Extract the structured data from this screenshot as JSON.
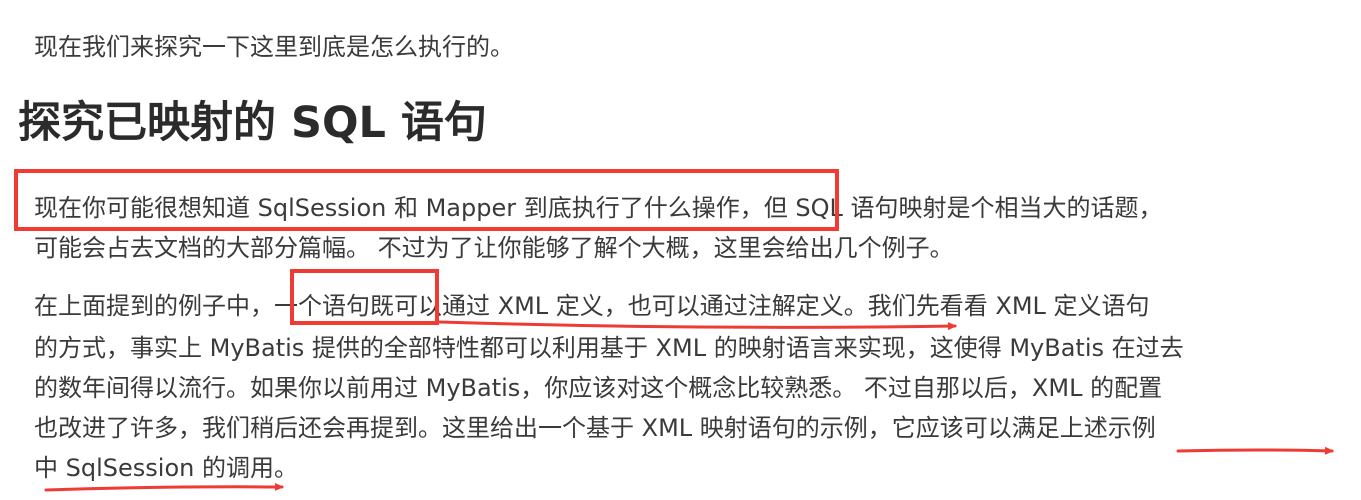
{
  "intro": "现在我们来探究一下这里到底是怎么执行的。",
  "heading": "探究已映射的 SQL 语句",
  "paragraph1": {
    "line1": "现在你可能很想知道 SqlSession 和 Mapper 到底执行了什么操作，但 SQL 语句映射是个相当大的话题，",
    "line2": "可能会占去文档的大部分篇幅。 不过为了让你能够了解个大概，这里会给出几个例子。"
  },
  "paragraph2": {
    "line1": "在上面提到的例子中，一个语句既可以通过 XML 定义，也可以通过注解定义。我们先看看 XML 定义语句",
    "line2": "的方式，事实上 MyBatis 提供的全部特性都可以利用基于 XML 的映射语言来实现，这使得 MyBatis 在过去",
    "line3": "的数年间得以流行。如果你以前用过 MyBatis，你应该对这个概念比较熟悉。 不过自那以后，XML 的配置",
    "line4": "也改进了许多，我们稍后还会再提到。这里给出一个基于 XML 映射语句的示例，它应该可以满足上述示例",
    "line5": "中 SqlSession 的调用。"
  },
  "annotation_color": "#ee3b34"
}
